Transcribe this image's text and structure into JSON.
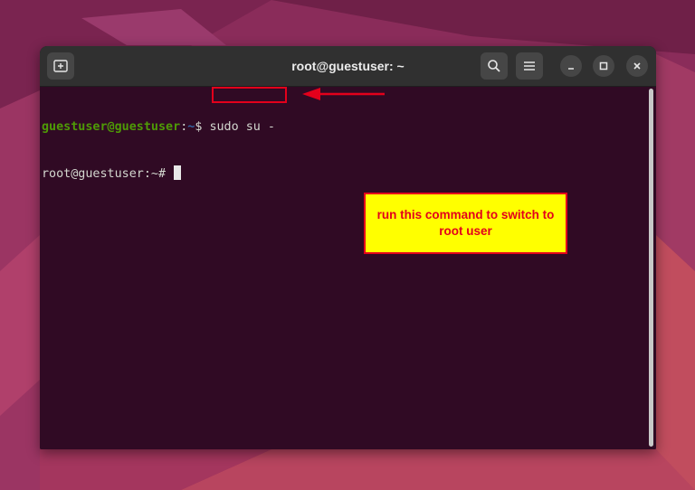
{
  "window": {
    "title": "root@guestuser: ~",
    "new_tab_icon": "new-tab-icon",
    "search_icon": "search-icon",
    "menu_icon": "hamburger-menu-icon",
    "minimize_icon": "minimize-icon",
    "maximize_icon": "maximize-icon",
    "close_icon": "close-icon"
  },
  "terminal": {
    "line1": {
      "user_host": "guestuser@guestuser",
      "colon": ":",
      "path": "~",
      "prompt_symbol": "$ ",
      "command": "sudo su -"
    },
    "line2": {
      "prompt": "root@guestuser:~# "
    }
  },
  "annotation": {
    "note_text": "run this command to switch to root user",
    "highlight_color": "#e3001b",
    "note_background": "#ffff00"
  },
  "colors": {
    "terminal_bg": "#300a24",
    "titlebar_bg": "#303030",
    "user_host": "#4e9a06",
    "path": "#3465a4"
  }
}
